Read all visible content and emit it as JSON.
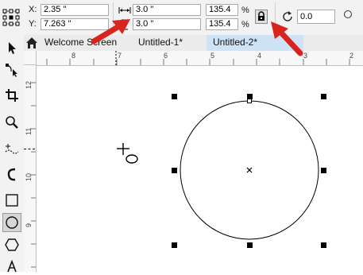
{
  "propbar": {
    "x_label": "X:",
    "x_value": "2.35 \"",
    "y_label": "Y:",
    "y_value": "7.263 \"",
    "width_value": "3.0 \"",
    "height_value": "3.0 \"",
    "scale_x_value": "135.4",
    "scale_y_value": "135.4",
    "percent_1": "%",
    "percent_2": "%",
    "rotation_value": "0.0"
  },
  "tabs": [
    {
      "label": "Welcome Screen"
    },
    {
      "label": "Untitled-1*"
    },
    {
      "label": "Untitled-2*"
    }
  ],
  "ruler": {
    "h_numbers": [
      "8",
      "7",
      "6",
      "5",
      "4",
      "3",
      "2"
    ],
    "v_numbers": [
      "12",
      "11",
      "10",
      "9"
    ]
  },
  "colors": {
    "arrow": "#d9231d",
    "active_tab": "#cfe3f7",
    "handles": "#000000"
  },
  "icons": [
    "select-tool-icon",
    "shape-tool-icon",
    "crop-tool-icon",
    "zoom-tool-icon",
    "freehand-tool-icon",
    "artistic-media-icon",
    "rectangle-tool-icon",
    "ellipse-tool-icon",
    "polygon-tool-icon",
    "text-tool-icon",
    "lock-ratio-icon",
    "rotate-icon",
    "home-icon"
  ]
}
